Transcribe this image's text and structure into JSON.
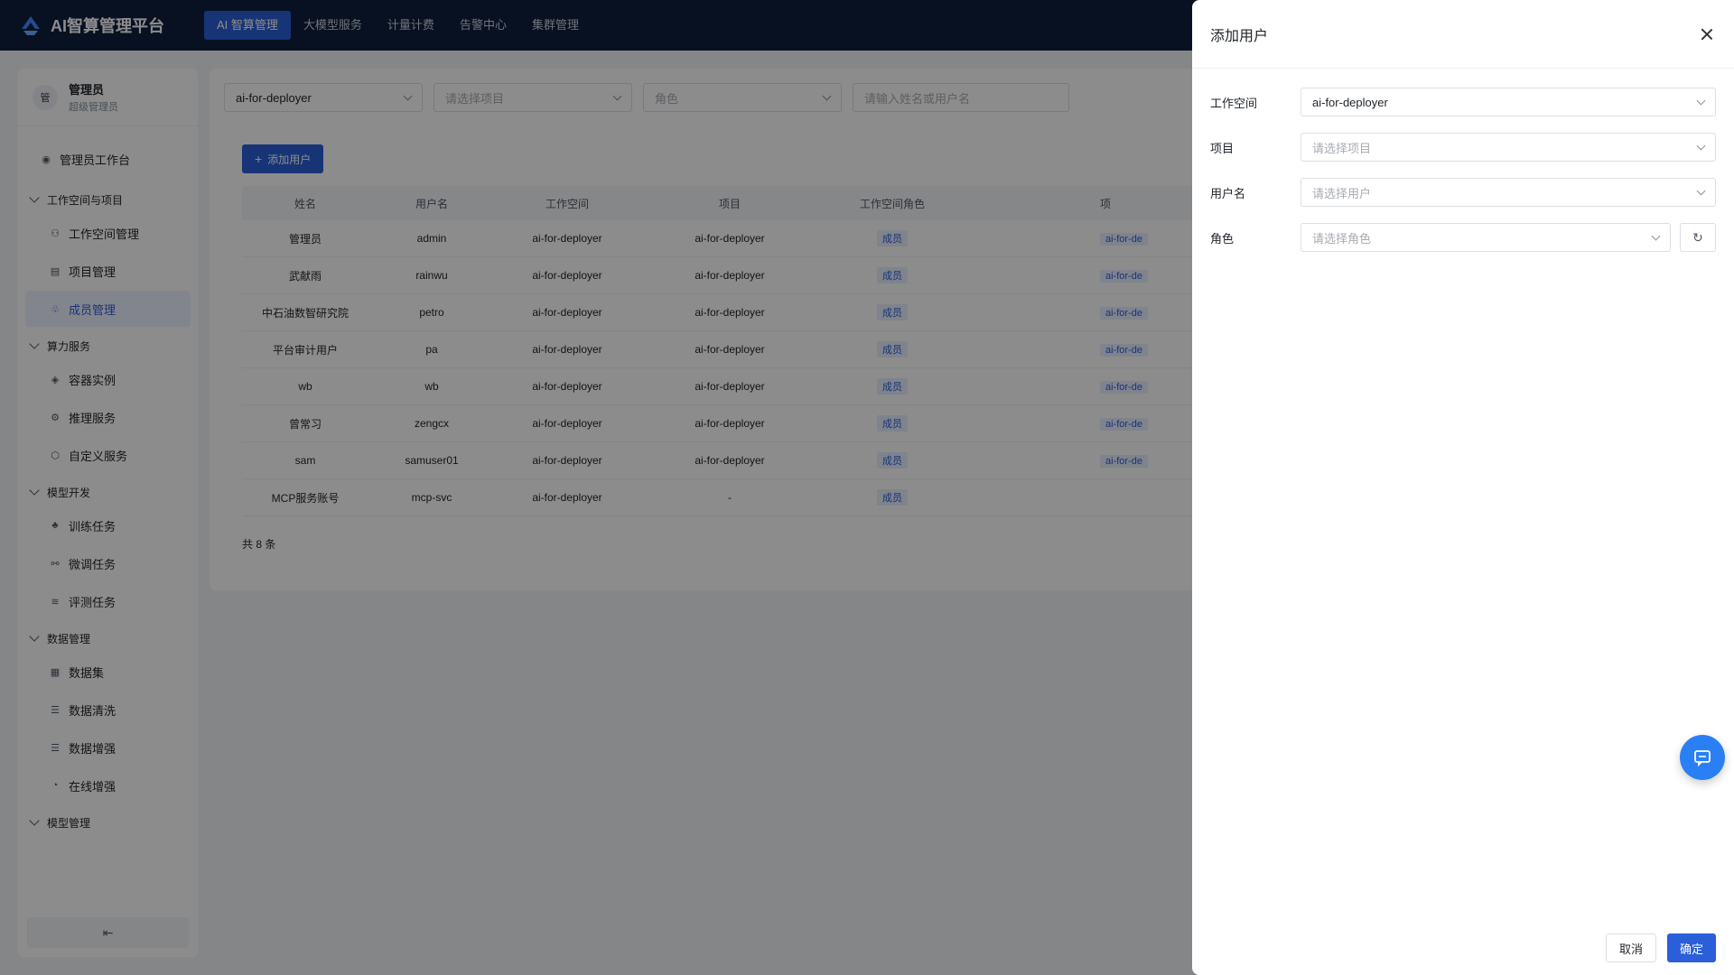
{
  "app": {
    "title": "AI智算管理平台"
  },
  "nav": [
    "AI 智算管理",
    "大模型服务",
    "计量计费",
    "告警中心",
    "集群管理"
  ],
  "user": {
    "avatar": "管",
    "name": "管理员",
    "role": "超级管理员"
  },
  "sidebar": {
    "top_item": "管理员工作台",
    "groups": [
      {
        "title": "工作空间与项目",
        "items": [
          "工作空间管理",
          "项目管理",
          "成员管理"
        ]
      },
      {
        "title": "算力服务",
        "items": [
          "容器实例",
          "推理服务",
          "自定义服务"
        ]
      },
      {
        "title": "模型开发",
        "items": [
          "训练任务",
          "微调任务",
          "评测任务"
        ]
      },
      {
        "title": "数据管理",
        "items": [
          "数据集",
          "数据清洗",
          "数据增强",
          "在线增强"
        ]
      },
      {
        "title": "模型管理",
        "items": []
      }
    ],
    "active_item": "成员管理",
    "collapse_icon": "⇤"
  },
  "filters": {
    "workspace": "ai-for-deployer",
    "project_placeholder": "请选择项目",
    "role_placeholder": "角色",
    "search_placeholder": "请输入姓名或用户名"
  },
  "add_user_button": "添加用户",
  "table": {
    "headers": [
      "姓名",
      "用户名",
      "工作空间",
      "项目",
      "工作空间角色",
      "项"
    ],
    "rows": [
      {
        "name": "管理员",
        "username": "admin",
        "workspace": "ai-for-deployer",
        "project": "ai-for-deployer",
        "role": "成员",
        "extra": "ai-for-de"
      },
      {
        "name": "武献雨",
        "username": "rainwu",
        "workspace": "ai-for-deployer",
        "project": "ai-for-deployer",
        "role": "成员",
        "extra": "ai-for-de"
      },
      {
        "name": "中石油数智研究院",
        "username": "petro",
        "workspace": "ai-for-deployer",
        "project": "ai-for-deployer",
        "role": "成员",
        "extra": "ai-for-de"
      },
      {
        "name": "平台审计用户",
        "username": "pa",
        "workspace": "ai-for-deployer",
        "project": "ai-for-deployer",
        "role": "成员",
        "extra": "ai-for-de"
      },
      {
        "name": "wb",
        "username": "wb",
        "workspace": "ai-for-deployer",
        "project": "ai-for-deployer",
        "role": "成员",
        "extra": "ai-for-de"
      },
      {
        "name": "曾常习",
        "username": "zengcx",
        "workspace": "ai-for-deployer",
        "project": "ai-for-deployer",
        "role": "成员",
        "extra": "ai-for-de"
      },
      {
        "name": "sam",
        "username": "samuser01",
        "workspace": "ai-for-deployer",
        "project": "ai-for-deployer",
        "role": "成员",
        "extra": "ai-for-de"
      },
      {
        "name": "MCP服务账号",
        "username": "mcp-svc",
        "workspace": "ai-for-deployer",
        "project": "-",
        "role": "成员",
        "extra": ""
      }
    ],
    "total": "共 8 条"
  },
  "drawer": {
    "title": "添加用户",
    "fields": {
      "workspace_label": "工作空间",
      "workspace_value": "ai-for-deployer",
      "project_label": "项目",
      "project_placeholder": "请选择项目",
      "username_label": "用户名",
      "username_placeholder": "请选择用户",
      "role_label": "角色",
      "role_placeholder": "请选择角色"
    },
    "cancel": "取消",
    "confirm": "确定"
  },
  "colors": {
    "primary": "#2b5fd9",
    "nav_bg": "#0f1f3d",
    "fab": "#2b7ff5"
  }
}
